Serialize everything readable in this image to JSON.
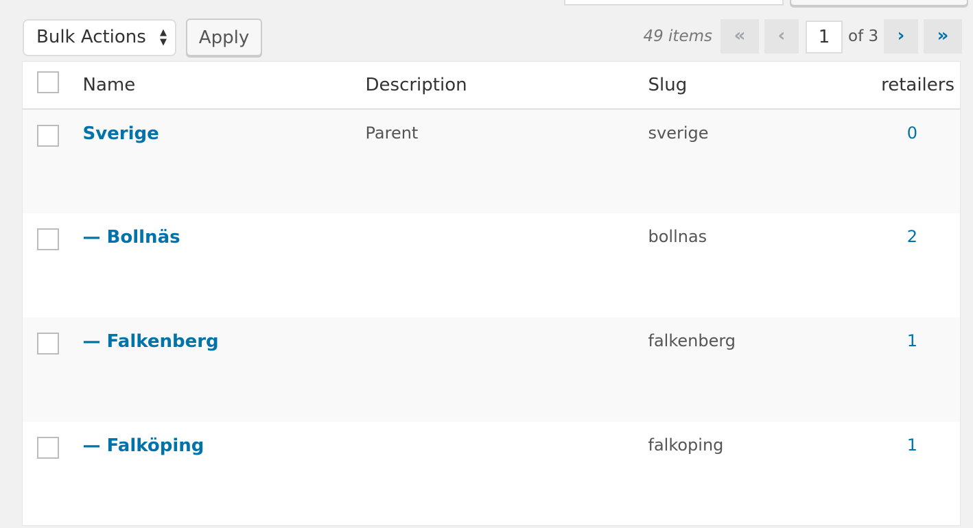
{
  "toolbar": {
    "bulk_actions": "Bulk Actions",
    "apply": "Apply",
    "items_count": "49 items",
    "first": "«",
    "prev": "‹",
    "current_page": "1",
    "of_pages": "of 3",
    "next": "›",
    "last": "»"
  },
  "table": {
    "headers": {
      "name": "Name",
      "description": "Description",
      "slug": "Slug",
      "retailers": "retailers"
    },
    "rows": [
      {
        "name": "Sverige",
        "description": "Parent",
        "slug": "sverige",
        "retailers": "0"
      },
      {
        "name": "— Bollnäs",
        "description": "",
        "slug": "bollnas",
        "retailers": "2"
      },
      {
        "name": "— Falkenberg",
        "description": "",
        "slug": "falkenberg",
        "retailers": "1"
      },
      {
        "name": "— Falköping",
        "description": "",
        "slug": "falkoping",
        "retailers": "1"
      }
    ]
  },
  "colors": {
    "link": "#0073aa",
    "background": "#f1f1f1"
  }
}
